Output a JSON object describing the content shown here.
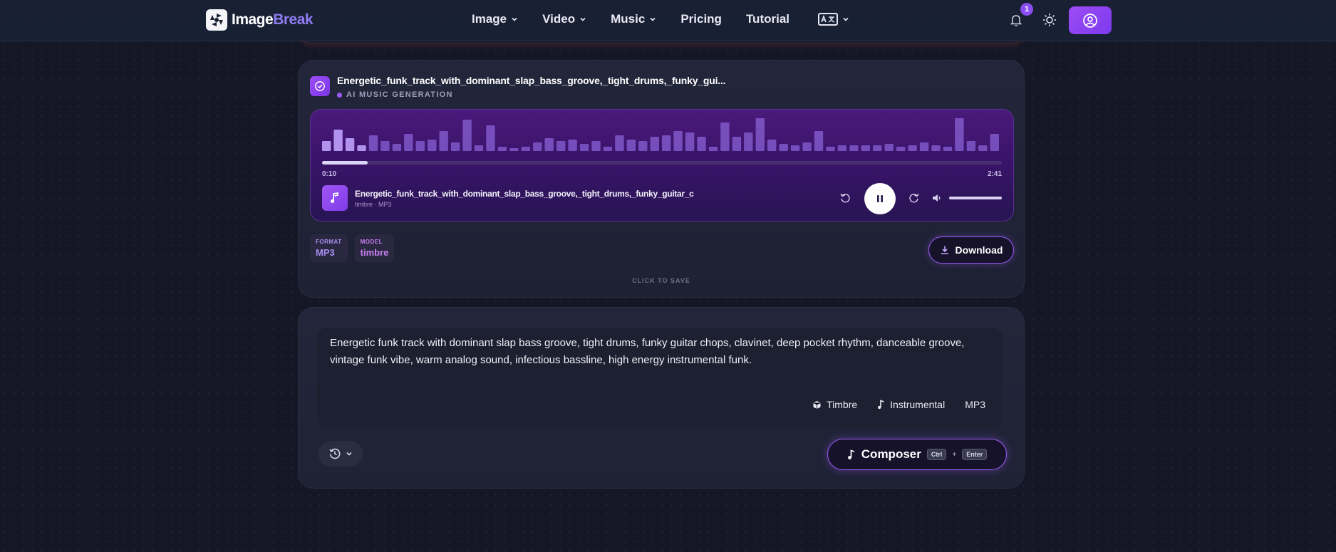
{
  "brand": {
    "name_part1": "Image",
    "name_part2": "Break"
  },
  "nav": {
    "items": [
      {
        "label": "Image",
        "dropdown": true
      },
      {
        "label": "Video",
        "dropdown": true
      },
      {
        "label": "Music",
        "dropdown": true
      },
      {
        "label": "Pricing",
        "dropdown": false
      },
      {
        "label": "Tutorial",
        "dropdown": false
      }
    ],
    "language_icon": "translate-icon",
    "notifications_count": "1"
  },
  "result": {
    "title": "Energetic_funk_track_with_dominant_slap_bass_groove,_tight_drums,_funky_gui...",
    "subtitle": "AI MUSIC GENERATION",
    "player": {
      "current_time": "0:10",
      "total_time": "2:41",
      "progress": 0.067,
      "track_name": "Energetic_funk_track_with_dominant_slap_bass_groove,_tight_drums,_funky_guitar_c",
      "track_meta": "timbre · MP3",
      "volume": 1.0
    },
    "format": {
      "label": "FORMAT",
      "value": "MP3"
    },
    "model": {
      "label": "MODEL",
      "value": "timbre"
    },
    "download_label": "Download",
    "save_hint": "CLICK TO SAVE"
  },
  "composer": {
    "prompt": "Energetic funk track with dominant slap bass groove, tight drums, funky guitar chops, clavinet, deep pocket rhythm, danceable groove, vintage funk vibe, warm analog sound, infectious bassline, high energy instrumental funk.",
    "options": [
      {
        "label": "Timbre",
        "icon": "cube-icon"
      },
      {
        "label": "Instrumental",
        "icon": "music-note-icon"
      },
      {
        "label": "MP3",
        "icon": ""
      }
    ],
    "button_label": "Composer",
    "shortcut_key1": "Ctrl",
    "shortcut_plus": "+",
    "shortcut_key2": "Enter"
  },
  "colors": {
    "accent": "#9b5cf6",
    "background": "#151727",
    "card": "#23263a"
  }
}
